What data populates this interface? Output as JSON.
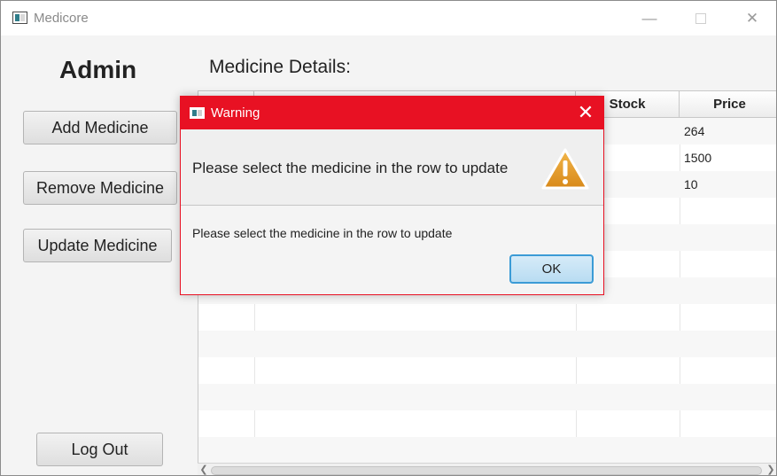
{
  "window": {
    "title": "Medicore",
    "minimize": "—",
    "close": "✕"
  },
  "sidebar": {
    "heading": "Admin",
    "add_label": "Add Medicine",
    "remove_label": "Remove Medicine",
    "update_label": "Update Medicine",
    "logout_label": "Log Out"
  },
  "main": {
    "title": "Medicine Details:",
    "table": {
      "headers": [
        "",
        "",
        "Stock",
        "Price"
      ],
      "rows": [
        [
          "",
          "",
          "",
          "264"
        ],
        [
          "",
          "",
          "",
          "1500"
        ],
        [
          "",
          "",
          "",
          "10"
        ]
      ]
    }
  },
  "dialog": {
    "title": "Warning",
    "close": "✕",
    "header_text": "Please select the medicine in the row to update",
    "content_text": "Please select the medicine in the row to update",
    "ok_label": "OK",
    "icon": "warning-icon",
    "accent": "#e81123"
  }
}
